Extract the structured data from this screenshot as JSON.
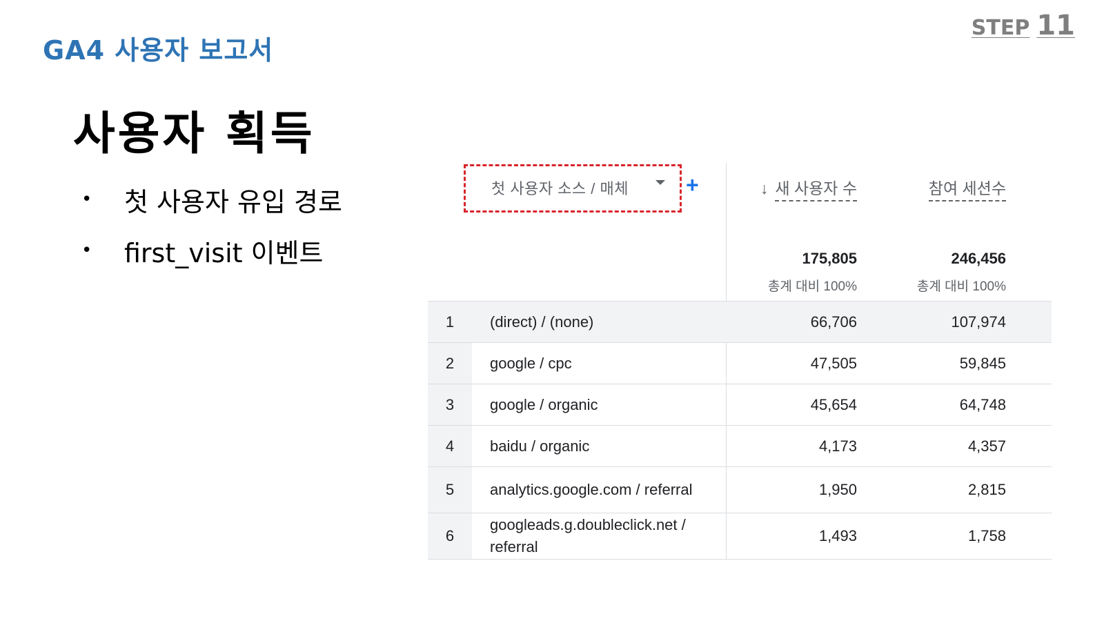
{
  "slide": {
    "section_label": "GA4 사용자 보고서",
    "step_word": "STEP",
    "step_number": "11",
    "title": "사용자 획득",
    "bullets": [
      "첫 사용자 유입 경로",
      "first_visit 이벤트"
    ]
  },
  "report": {
    "dimension_label": "첫 사용자 소스 / 매체",
    "columns": [
      {
        "label": "새 사용자 수",
        "sorted": true
      },
      {
        "label": "참여 세션수",
        "sorted": false
      }
    ],
    "totals": [
      {
        "value": "175,805",
        "pct": "총계 대비 100%"
      },
      {
        "value": "246,456",
        "pct": "총계 대비 100%"
      }
    ],
    "rows": [
      {
        "index": "1",
        "name": "(direct) / (none)",
        "new_users": "66,706",
        "sessions": "107,974"
      },
      {
        "index": "2",
        "name": "google / cpc",
        "new_users": "47,505",
        "sessions": "59,845"
      },
      {
        "index": "3",
        "name": "google / organic",
        "new_users": "45,654",
        "sessions": "64,748"
      },
      {
        "index": "4",
        "name": "baidu / organic",
        "new_users": "4,173",
        "sessions": "4,357"
      },
      {
        "index": "5",
        "name": "analytics.google.com / referral",
        "new_users": "1,950",
        "sessions": "2,815"
      },
      {
        "index": "6",
        "name": "googleads.g.doubleclick.net / referral",
        "new_users": "1,493",
        "sessions": "1,758"
      }
    ]
  },
  "icons": {
    "dropdown": "chevron-down-icon",
    "add": "plus-icon",
    "sort": "arrow-down-icon"
  },
  "colors": {
    "section_label": "#2e74b5",
    "highlight_box": "#d9242b",
    "add_icon": "#1a73e8",
    "row_stripe": "#f1f3f4"
  }
}
